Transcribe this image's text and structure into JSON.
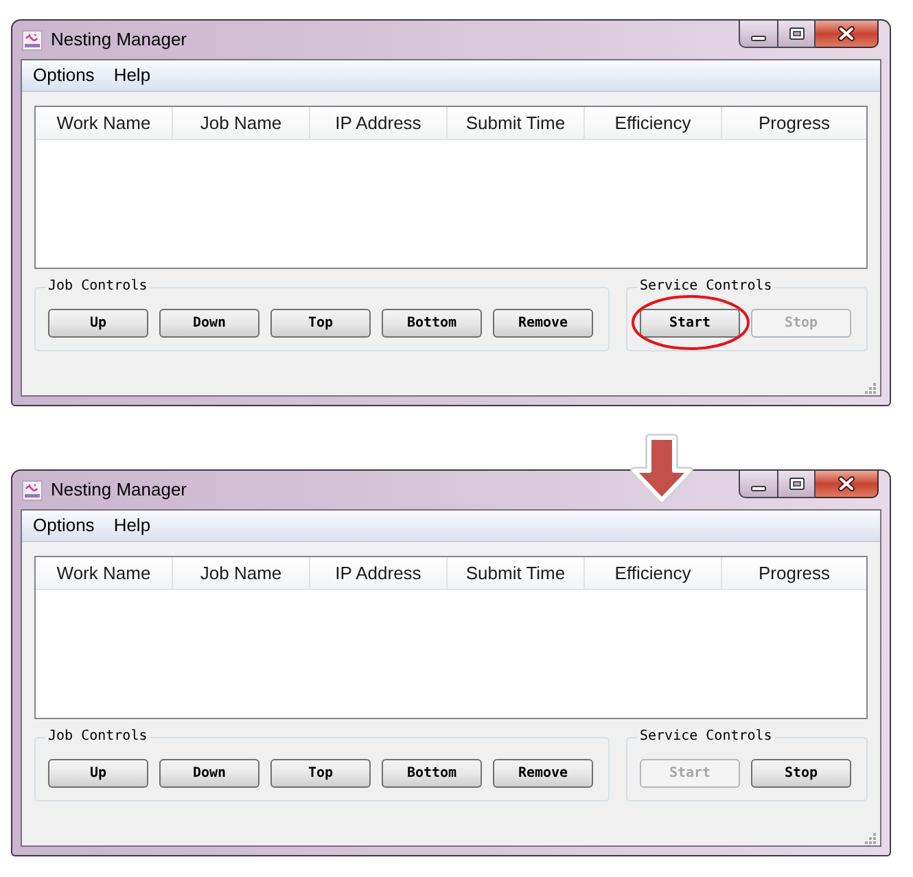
{
  "windows": [
    {
      "title": "Nesting Manager",
      "menu": [
        "Options",
        "Help"
      ],
      "table": {
        "columns": [
          "Work Name",
          "Job Name",
          "IP Address",
          "Submit Time",
          "Efficiency",
          "Progress"
        ]
      },
      "groups": [
        {
          "title": "Job Controls",
          "buttons": [
            {
              "label": "Up",
              "disabled": false,
              "circled": false
            },
            {
              "label": "Down",
              "disabled": false,
              "circled": false
            },
            {
              "label": "Top",
              "disabled": false,
              "circled": false
            },
            {
              "label": "Bottom",
              "disabled": false,
              "circled": false
            },
            {
              "label": "Remove",
              "disabled": false,
              "circled": false
            }
          ]
        },
        {
          "title": "Service Controls",
          "buttons": [
            {
              "label": "Start",
              "disabled": false,
              "circled": true
            },
            {
              "label": "Stop",
              "disabled": true,
              "circled": false
            }
          ]
        }
      ]
    },
    {
      "title": "Nesting Manager",
      "menu": [
        "Options",
        "Help"
      ],
      "table": {
        "columns": [
          "Work Name",
          "Job Name",
          "IP Address",
          "Submit Time",
          "Efficiency",
          "Progress"
        ]
      },
      "groups": [
        {
          "title": "Job Controls",
          "buttons": [
            {
              "label": "Up",
              "disabled": false,
              "circled": false
            },
            {
              "label": "Down",
              "disabled": false,
              "circled": false
            },
            {
              "label": "Top",
              "disabled": false,
              "circled": false
            },
            {
              "label": "Bottom",
              "disabled": false,
              "circled": false
            },
            {
              "label": "Remove",
              "disabled": false,
              "circled": false
            }
          ]
        },
        {
          "title": "Service Controls",
          "buttons": [
            {
              "label": "Start",
              "disabled": true,
              "circled": false
            },
            {
              "label": "Stop",
              "disabled": false,
              "circled": false
            }
          ]
        }
      ]
    }
  ]
}
